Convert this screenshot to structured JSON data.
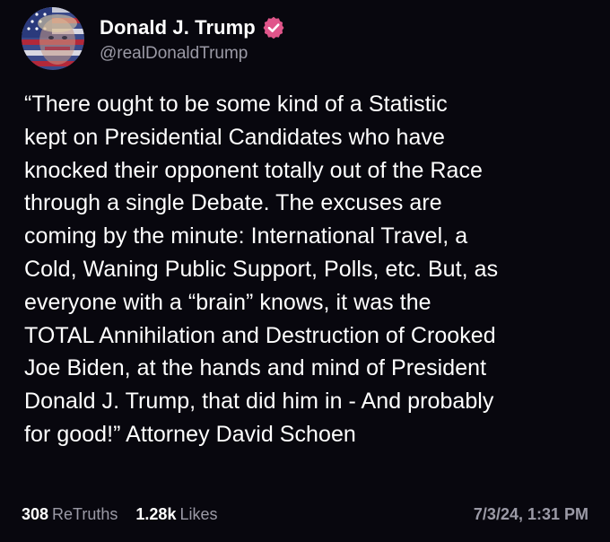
{
  "author": {
    "display_name": "Donald J. Trump",
    "handle": "@realDonaldTrump",
    "verified_icon": "verified-badge-icon",
    "badge_color": "#e0558a"
  },
  "post": {
    "text": "“There ought to be some kind of a Statistic\nkept on Presidential Candidates who have\nknocked their opponent totally out of the Race\nthrough a single Debate. The excuses are\ncoming by the minute: International Travel, a\nCold, Waning Public Support, Polls, etc. But, as\neveryone with a “brain” knows, it was the\nTOTAL Annihilation and Destruction of Crooked\nJoe Biden, at the hands and mind of President\nDonald J. Trump, that did him in - And probably\nfor good!” Attorney David Schoen"
  },
  "stats": {
    "retruths_count": "308",
    "retruths_label": "ReTruths",
    "likes_count": "1.28k",
    "likes_label": "Likes",
    "timestamp": "7/3/24, 1:31 PM"
  }
}
